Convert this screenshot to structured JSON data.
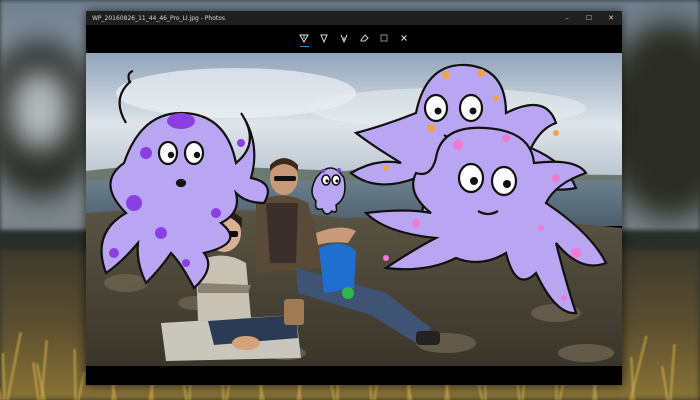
{
  "window": {
    "title": "WP_20160826_11_44_46_Pro_LI.jpg - Photos",
    "controls": [
      "–",
      "☐",
      "✕"
    ]
  },
  "toolbar": {
    "tools": [
      {
        "name": "ballpoint-pen-icon",
        "active": true
      },
      {
        "name": "pencil-icon",
        "active": false
      },
      {
        "name": "calligraphy-pen-icon",
        "active": false
      },
      {
        "name": "eraser-icon",
        "active": false
      },
      {
        "name": "ruler-icon",
        "active": false
      },
      {
        "name": "close-icon",
        "active": false
      }
    ]
  },
  "photo": {
    "description_icons": [
      "octopus-drawing",
      "octopus-drawing",
      "octopus-drawing",
      "octopus-drawing"
    ],
    "colors": {
      "octopus_fill": "#b9a6f2",
      "octopus_spot": "#8b3fe0",
      "octopus_spot_pink": "#f07ad0",
      "octopus_spot_orange": "#f2a24a",
      "sky": "#c9d3dc",
      "sea": "#586c7a",
      "rock": "#4b4535"
    }
  }
}
